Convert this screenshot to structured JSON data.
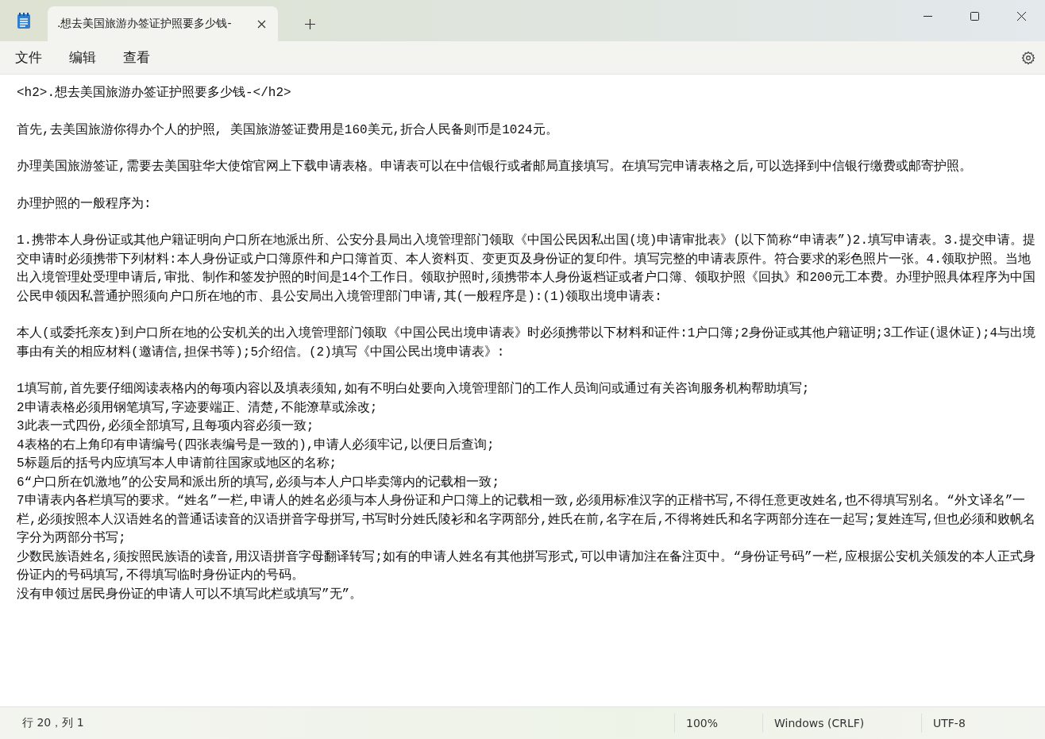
{
  "window": {
    "tab_title": ".想去美国旅游办签证护照要多少钱-"
  },
  "menu": [
    "文件",
    "编辑",
    "查看"
  ],
  "document": {
    "blocks": [
      [
        "<h2>.想去美国旅游办签证护照要多少钱-</h2>"
      ],
      [
        "首先,去美国旅游你得办个人的护照, 美国旅游签证费用是160美元,折合人民备则币是1024元。"
      ],
      [
        "办理美国旅游签证,需要去美国驻华大使馆官网上下载申请表格。申请表可以在中信银行或者邮局直接填写。在填写完申请表格之后,可以选择到中信银行缴费或邮寄护照。"
      ],
      [
        "办理护照的一般程序为:"
      ],
      [
        "1.携带本人身份证或其他户籍证明向户口所在地派出所、公安分县局出入境管理部门领取《中国公民因私出国(境)申请审批表》(以下简称“申请表”)2.填写申请表。3.提交申请。提交申请时必须携带下列材料:本人身份证或户口簿原件和户口簿首页、本人资料页、变更页及身份证的复印件。填写完整的申请表原件。符合要求的彩色照片一张。4.领取护照。当地出入境管理处受理申请后,审批、制作和签发护照的时间是14个工作日。领取护照时,须携带本人身份返档证或者户口簿、领取护照《回执》和200元工本费。办理护照具体程序为中国公民申领因私普通护照须向户口所在地的市、县公安局出入境管理部门申请,其(一般程序是):(1)领取出境申请表:"
      ],
      [
        "本人(或委托亲友)到户口所在地的公安机关的出入境管理部门领取《中国公民出境申请表》时必须携带以下材料和证件:1户口簿;2身份证或其他户籍证明;3工作证(退休证);4与出境事由有关的相应材料(邀请信,担保书等);5介绍信。(2)填写《中国公民出境申请表》:"
      ],
      [
        "1填写前,首先要仔细阅读表格内的每项内容以及填表须知,如有不明白处要向入境管理部门的工作人员询问或通过有关咨询服务机构帮助填写;",
        "2申请表格必须用钢笔填写,字迹要端正、清楚,不能潦草或涂改;",
        "3此表一式四份,必须全部填写,且每项内容必须一致;",
        "4表格的右上角印有申请编号(四张表编号是一致的),申请人必须牢记,以便日后查询;",
        "5标题后的括号内应填写本人申请前往国家或地区的名称;",
        "6“户口所在饥激地”的公安局和派出所的填写,必须与本人户口毕卖簿内的记载相一致;",
        "7申请表内各栏填写的要求。“姓名”一栏,申请人的姓名必须与本人身份证和户口簿上的记载相一致,必须用标准汉字的正楷书写,不得任意更改姓名,也不得填写别名。“外文译名”一栏,必须按照本人汉语姓名的普通话读音的汉语拼音字母拼写,书写时分姓氏陵衫和名字两部分,姓氏在前,名字在后,不得将姓氏和名字两部分连在一起写;复姓连写,但也必须和败帆名字分为两部分书写;",
        "少数民族语姓名,须按照民族语的读音,用汉语拼音字母翻译转写;如有的申请人姓名有其他拼写形式,可以申请加注在备注页中。“身份证号码”一栏,应根据公安机关颁发的本人正式身份证内的号码填写,不得填写临时身份证内的号码。",
        "没有申领过居民身份证的申请人可以不填写此栏或填写”无”。"
      ]
    ]
  },
  "status_bar": {
    "position": "行 20，列 1",
    "zoom": "100%",
    "line_ending": "Windows (CRLF)",
    "encoding": "UTF-8"
  }
}
